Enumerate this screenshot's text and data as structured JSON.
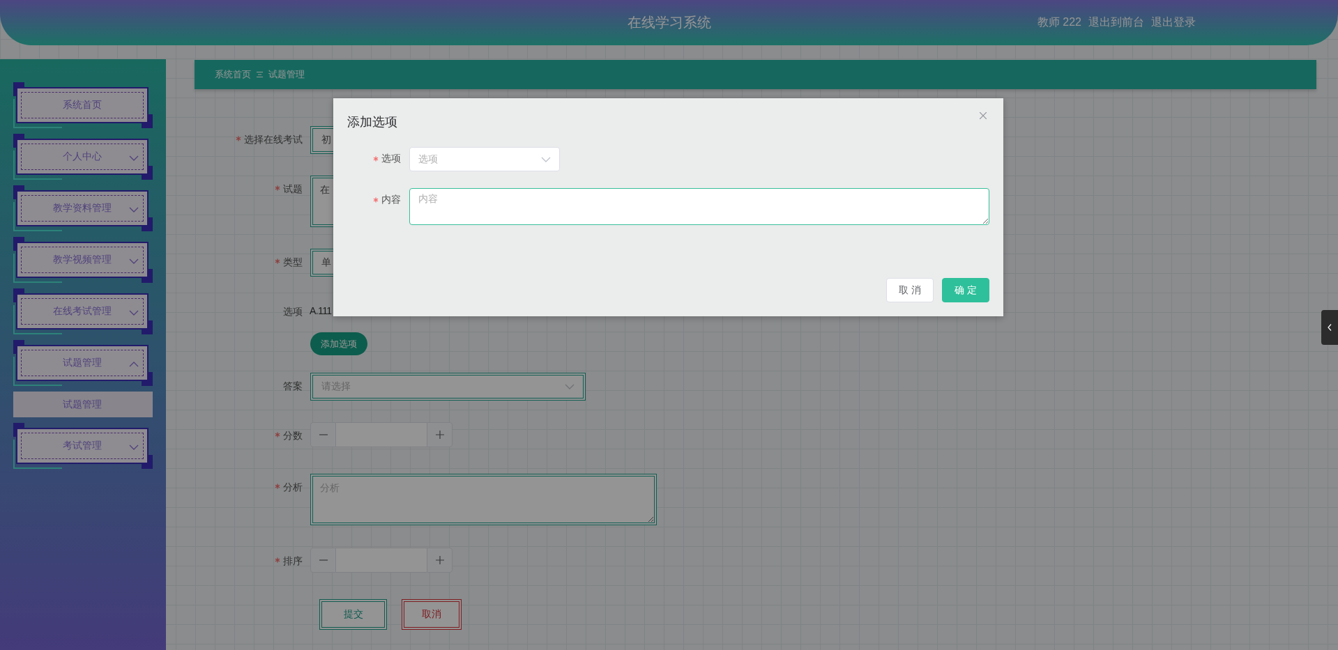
{
  "header": {
    "title": "在线学习系统",
    "user": "教师 222",
    "links": [
      "退出到前台",
      "退出登录"
    ]
  },
  "sidebar": {
    "items": [
      {
        "label": "系统首页",
        "kind": "link"
      },
      {
        "label": "个人中心",
        "kind": "group",
        "expanded": false
      },
      {
        "label": "教学资料管理",
        "kind": "group",
        "expanded": false
      },
      {
        "label": "教学视频管理",
        "kind": "group",
        "expanded": false
      },
      {
        "label": "在线考试管理",
        "kind": "group",
        "expanded": false
      },
      {
        "label": "试题管理",
        "kind": "group",
        "expanded": true,
        "children": [
          {
            "label": "试题管理",
            "selected": true
          }
        ]
      },
      {
        "label": "考试管理",
        "kind": "group",
        "expanded": false
      }
    ]
  },
  "breadcrumb": [
    "系统首页",
    "试题管理"
  ],
  "form": {
    "fields": [
      {
        "kind": "select",
        "label": "选择在线考试",
        "required": true,
        "value": "初"
      },
      {
        "kind": "textarea",
        "label": "试题",
        "required": true,
        "value": "在"
      },
      {
        "kind": "select",
        "label": "类型",
        "required": true,
        "value": "单"
      },
      {
        "kind": "options",
        "label": "选项",
        "required": false,
        "items": [
          {
            "text": "A.111"
          }
        ],
        "add_button": "添加选项"
      },
      {
        "kind": "select",
        "label": "答案",
        "required": false,
        "placeholder": "请选择"
      },
      {
        "kind": "number",
        "label": "分数",
        "required": true
      },
      {
        "kind": "textarea",
        "label": "分析",
        "required": true,
        "placeholder": "分析"
      },
      {
        "kind": "number",
        "label": "排序",
        "required": true
      }
    ],
    "buttons": [
      {
        "label": "提交",
        "kind": "submit"
      },
      {
        "label": "取消",
        "kind": "cancel"
      }
    ]
  },
  "dialog": {
    "title": "添加选项",
    "fields": [
      {
        "kind": "select",
        "label": "选项",
        "required": true,
        "placeholder": "选项"
      },
      {
        "kind": "textarea",
        "label": "内容",
        "required": true,
        "placeholder": "内容"
      }
    ],
    "buttons": [
      {
        "label": "取 消",
        "kind": "default"
      },
      {
        "label": "确 定",
        "kind": "primary"
      }
    ]
  }
}
